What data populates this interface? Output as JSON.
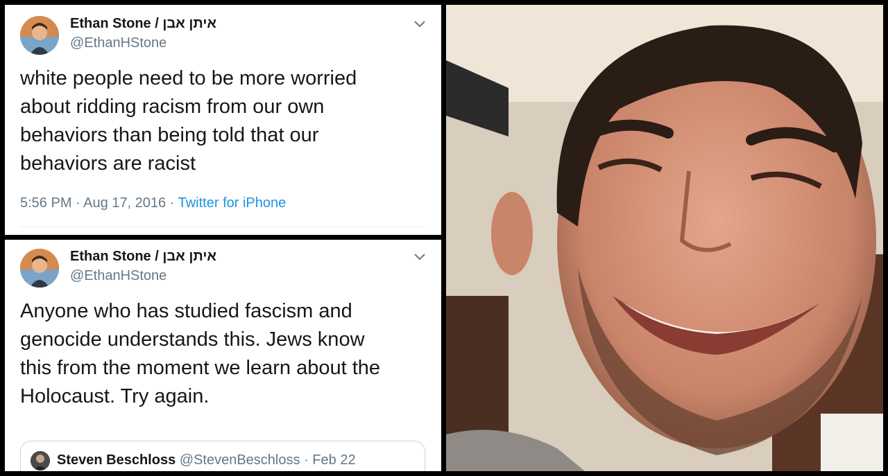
{
  "tweets": [
    {
      "name": "Ethan Stone / איתן אבן",
      "handle": "@EthanHStone",
      "text_lines": [
        "white people need to be more worried",
        "about ridding racism from our own",
        "behaviors than being told that our",
        "behaviors are racist"
      ],
      "time": "5:56 PM",
      "date": "Aug 17, 2016",
      "source": "Twitter for iPhone",
      "sep": "·"
    },
    {
      "name": "Ethan Stone / איתן אבן",
      "handle": "@EthanHStone",
      "text_lines": [
        "Anyone who has studied fascism and",
        "genocide understands this. Jews know",
        "this from the moment we learn about the",
        "Holocaust. Try again."
      ],
      "quote": {
        "name": "Steven Beschloss",
        "handle": "@StevenBeschloss",
        "sep": "·",
        "date": "Feb 22"
      }
    }
  ],
  "icons": {
    "avatar": "avatar-photo",
    "more": "chevron-down-icon"
  },
  "colors": {
    "text": "#14171a",
    "muted": "#657786",
    "link": "#1b95e0",
    "border": "#ccd6dd"
  }
}
